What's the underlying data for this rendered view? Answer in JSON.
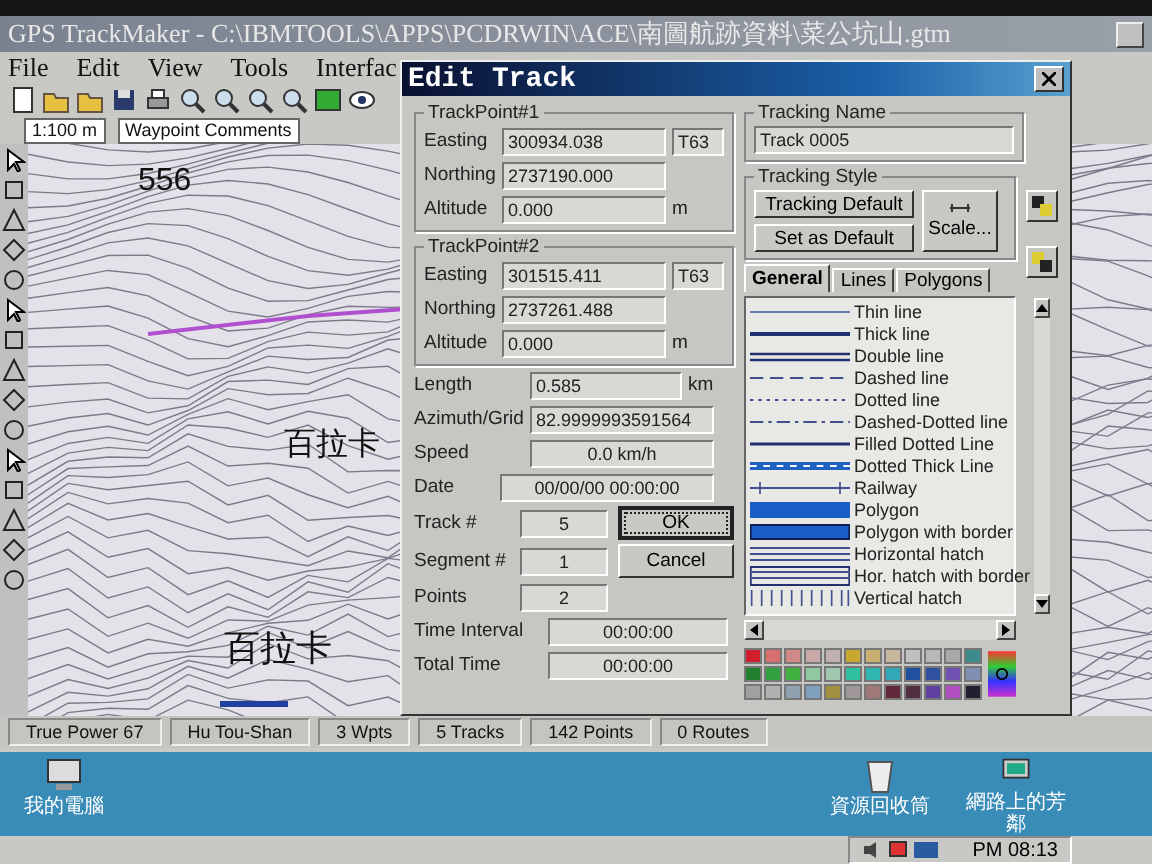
{
  "app": {
    "title": "GPS TrackMaker - C:\\IBMTOOLS\\APPS\\PCDRWIN\\ACE\\南圖航跡資料\\菜公坑山.gtm",
    "menu": [
      "File",
      "Edit",
      "View",
      "Tools",
      "Interfac"
    ],
    "scale": "1:100 m",
    "layer": "Waypoint Comments"
  },
  "map": {
    "labels": [
      "556",
      "百拉卡",
      "百拉卡"
    ]
  },
  "dialog": {
    "title": "Edit Track",
    "trackpoints": [
      {
        "title": "TrackPoint#1",
        "easting_label": "Easting",
        "easting": "300934.038",
        "zone": "T63",
        "northing_label": "Northing",
        "northing": "2737190.000",
        "altitude_label": "Altitude",
        "altitude": "0.000",
        "unit": "m"
      },
      {
        "title": "TrackPoint#2",
        "easting_label": "Easting",
        "easting": "301515.411",
        "zone": "T63",
        "northing_label": "Northing",
        "northing": "2737261.488",
        "altitude_label": "Altitude",
        "altitude": "0.000",
        "unit": "m"
      }
    ],
    "length": {
      "label": "Length",
      "value": "0.585",
      "unit": "km"
    },
    "azimuth": {
      "label": "Azimuth/Grid",
      "value": "82.9999993591564"
    },
    "speed": {
      "label": "Speed",
      "value": "0.0 km/h"
    },
    "date": {
      "label": "Date",
      "value": "00/00/00 00:00:00"
    },
    "counts": [
      {
        "label": "Track #",
        "value": "5"
      },
      {
        "label": "Segment #",
        "value": "1"
      },
      {
        "label": "Points",
        "value": "2"
      }
    ],
    "buttons": [
      {
        "label": "OK",
        "focused": true
      },
      {
        "label": "Cancel",
        "focused": false
      }
    ],
    "times": [
      {
        "label": "Time Interval",
        "value": "00:00:00"
      },
      {
        "label": "Total Time",
        "value": "00:00:00"
      }
    ],
    "tracking_name": {
      "title": "Tracking Name",
      "value": "Track 0005"
    },
    "tracking_style": {
      "title": "Tracking Style",
      "buttons": [
        "Tracking Default",
        "Set as Default"
      ],
      "scale_button": "Scale..."
    },
    "tabs": [
      {
        "label": "General",
        "selected": true
      },
      {
        "label": "Lines",
        "selected": false
      },
      {
        "label": "Polygons",
        "selected": false
      }
    ],
    "styles": [
      {
        "label": "Thin line",
        "kind": "thin"
      },
      {
        "label": "Thick line",
        "kind": "thick"
      },
      {
        "label": "Double line",
        "kind": "double"
      },
      {
        "label": "Dashed line",
        "kind": "dashed"
      },
      {
        "label": "Dotted line",
        "kind": "dotted"
      },
      {
        "label": "Dashed-Dotted line",
        "kind": "dashdot"
      },
      {
        "label": "Filled Dotted Line",
        "kind": "filleddotted"
      },
      {
        "label": "Dotted Thick Line",
        "kind": "dottedthick"
      },
      {
        "label": "Railway",
        "kind": "railway"
      },
      {
        "label": "Polygon",
        "kind": "polygon"
      },
      {
        "label": "Polygon with border",
        "kind": "polygonborder"
      },
      {
        "label": "Horizontal hatch",
        "kind": "hhatch"
      },
      {
        "label": "Hor. hatch with border",
        "kind": "hhatchborder"
      },
      {
        "label": "Vertical hatch",
        "kind": "vhatch"
      }
    ],
    "palette": [
      {
        "color": "#d02030"
      },
      {
        "color": "#d87070"
      },
      {
        "color": "#d08888"
      },
      {
        "color": "#c8a8a8"
      },
      {
        "color": "#c0b0b0"
      },
      {
        "color": "#c8a830"
      },
      {
        "color": "#c8b070"
      },
      {
        "color": "#c8b8a0"
      },
      {
        "color": "#c0c0c0"
      },
      {
        "color": "#b8b8b8"
      },
      {
        "color": "#a8a8a8"
      },
      {
        "color": "#3c8c8c"
      },
      {
        "color": "#208030"
      },
      {
        "color": "#30a040"
      },
      {
        "color": "#40b040"
      },
      {
        "color": "#90c8a0"
      },
      {
        "color": "#a0c8b0"
      },
      {
        "color": "#30c0a0"
      },
      {
        "color": "#30b8b0"
      },
      {
        "color": "#30a8b8"
      },
      {
        "color": "#2050a0"
      },
      {
        "color": "#3050a0"
      },
      {
        "color": "#7050b0"
      },
      {
        "color": "#8090b0"
      },
      {
        "color": "#a0a0a0"
      },
      {
        "color": "#b0b0b0"
      },
      {
        "color": "#90a0b0"
      },
      {
        "color": "#80a0c0"
      },
      {
        "color": "#a09040"
      },
      {
        "color": "#a09898"
      },
      {
        "color": "#a07878"
      },
      {
        "color": "#602838"
      },
      {
        "color": "#503040"
      },
      {
        "color": "#6040a0"
      },
      {
        "color": "#b050c0"
      },
      {
        "color": "#202030"
      }
    ]
  },
  "status_bar": [
    "True Power 67",
    "Hu Tou-Shan",
    "3 Wpts",
    "5 Tracks",
    "142 Points",
    "0 Routes"
  ],
  "desktop": {
    "icons": [
      "我的電腦",
      "資源回收筒",
      "網路上的芳鄰"
    ],
    "clock": "PM 08:13"
  }
}
